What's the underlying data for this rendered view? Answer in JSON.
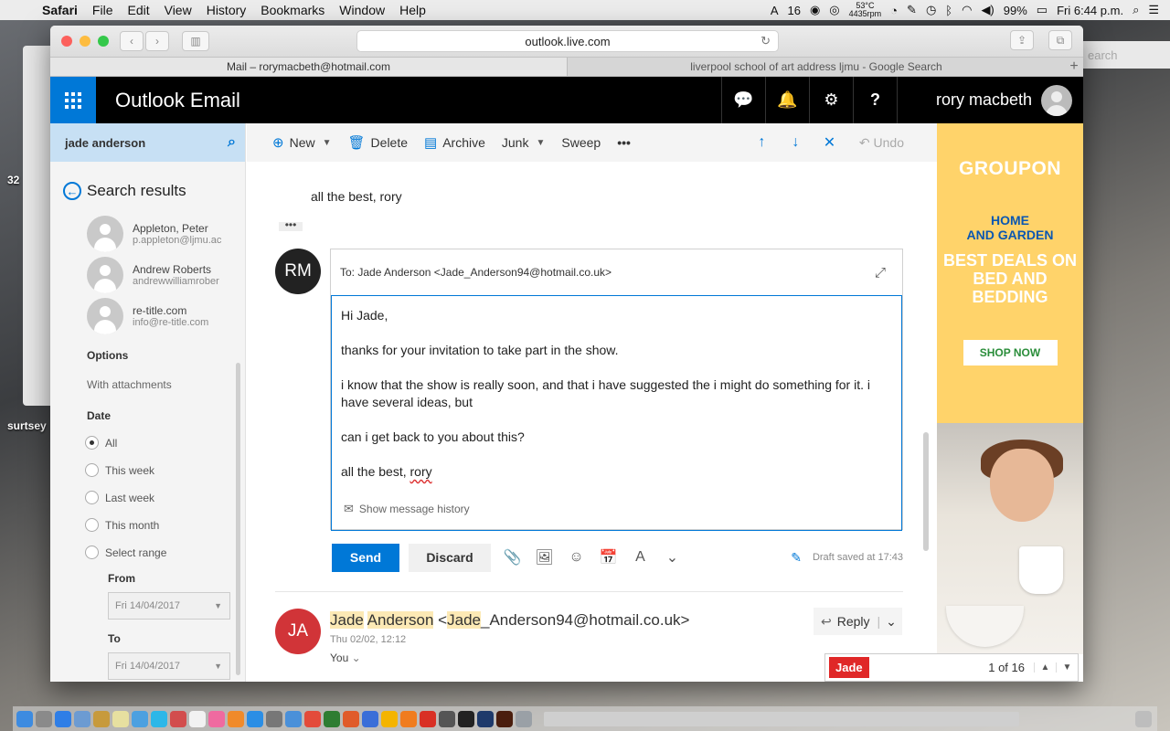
{
  "menubar": {
    "app": "Safari",
    "items": [
      "File",
      "Edit",
      "View",
      "History",
      "Bookmarks",
      "Window",
      "Help"
    ],
    "status": {
      "count": "16",
      "temp": "53°C",
      "rpm": "4435rpm",
      "battery": "99%",
      "clock": "Fri 6:44 p.m."
    }
  },
  "desktop": {
    "labels": [
      "32",
      "surtsey"
    ],
    "right_search": "earch"
  },
  "browser": {
    "url": "outlook.live.com",
    "tabs": [
      {
        "label": "Mail – rorymacbeth@hotmail.com",
        "active": true
      },
      {
        "label": "liverpool school of art address ljmu - Google Search",
        "active": false
      }
    ]
  },
  "outlook": {
    "title": "Outlook Email",
    "user_name": "rory macbeth",
    "search_query": "jade anderson",
    "search_results_label": "Search results",
    "people": [
      {
        "name": "Appleton, Peter",
        "email": "p.appleton@ljmu.ac"
      },
      {
        "name": "Andrew Roberts",
        "email": "andrewwilliamrober"
      },
      {
        "name": "re-title.com",
        "email": "info@re-title.com"
      }
    ],
    "options_label": "Options",
    "with_attachments": "With attachments",
    "date_label": "Date",
    "date_options": [
      "All",
      "This week",
      "Last week",
      "This month",
      "Select range"
    ],
    "date_selected": "All",
    "from_label": "From",
    "from_value": "Fri 14/04/2017",
    "to_label": "To",
    "to_value": "Fri 14/04/2017",
    "commands": {
      "new": "New",
      "delete": "Delete",
      "archive": "Archive",
      "junk": "Junk",
      "sweep": "Sweep",
      "more": "•••",
      "undo": "Undo"
    },
    "previous_signoff": "all the best, rory",
    "compose": {
      "avatar_initials": "RM",
      "to_label": "To:",
      "to_value": "Jade Anderson <Jade_Anderson94@hotmail.co.uk>",
      "body": {
        "greeting": "Hi Jade,",
        "line1": "thanks for your invitation to take part in the show.",
        "line2": "i know that the show is really soon, and that i have suggested the i might do something for it. i have several ideas, but",
        "line3": "can i get back to you about this?",
        "signoff": "all the best, ",
        "signature": "rory"
      },
      "show_history": "Show message history",
      "send": "Send",
      "discard": "Discard",
      "draft_status": "Draft saved at 17:43"
    },
    "thread_message": {
      "avatar_initials": "JA",
      "from_first": "Jade",
      "from_last": "Anderson",
      "from_addr_open": " <",
      "from_addr_hl": "Jade",
      "from_addr_rest": "_Anderson94@hotmail.co.uk>",
      "date": "Thu 02/02, 12:12",
      "to": "You",
      "reply": "Reply"
    },
    "find": {
      "term": "Jade",
      "count": "1 of 16"
    }
  },
  "ad": {
    "brand": "GROUPON",
    "headline1": "HOME",
    "headline2": "AND GARDEN",
    "deal": "BEST DEALS ON BED AND BEDDING",
    "cta": "SHOP NOW",
    "colors": {
      "background": "#ffd36a",
      "headline": "#0b57b1",
      "cta_text": "#2a8d3a"
    }
  },
  "colors": {
    "accent": "#0078d7",
    "header": "#000000",
    "ja_avatar": "#d13438",
    "highlight": "#fce9b5"
  }
}
